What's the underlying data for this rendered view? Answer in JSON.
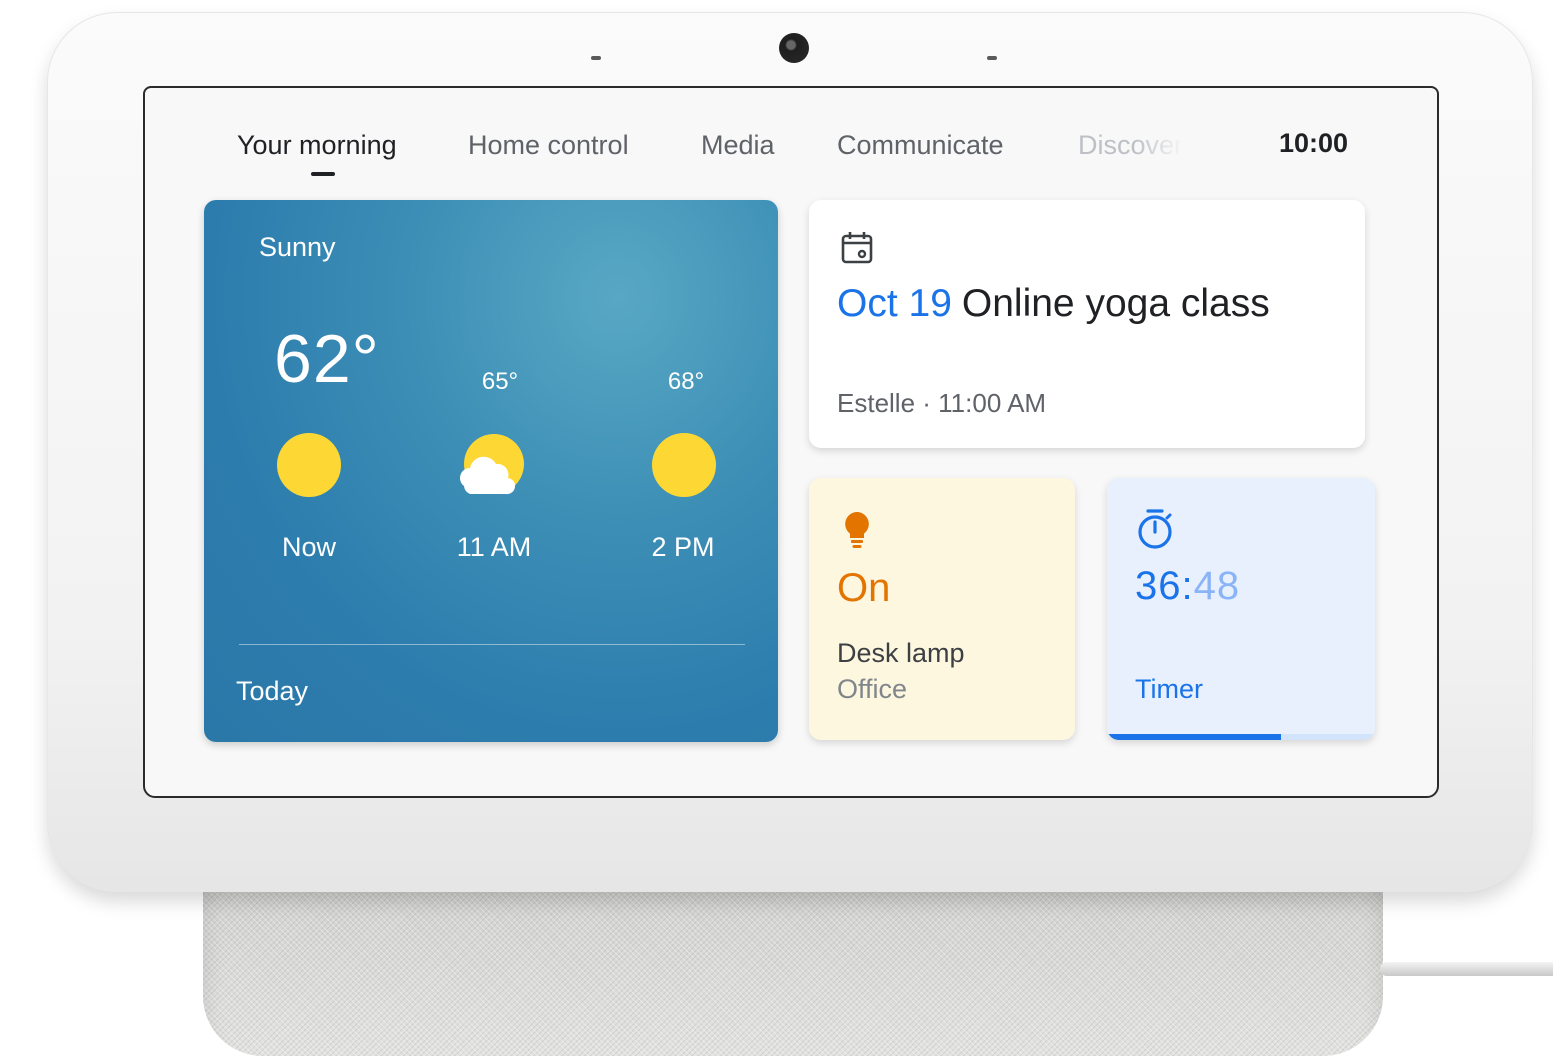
{
  "tabs": [
    {
      "label": "Your morning"
    },
    {
      "label": "Home control"
    },
    {
      "label": "Media"
    },
    {
      "label": "Communicate"
    },
    {
      "label": "Discover"
    }
  ],
  "clock": "10:00",
  "weather": {
    "condition": "Sunny",
    "current_temp": "62°",
    "forecast": [
      {
        "time": "Now",
        "icon": "sun-icon"
      },
      {
        "time": "11 AM",
        "temp": "65°",
        "icon": "partly-cloudy-icon"
      },
      {
        "time": "2 PM",
        "temp": "68°",
        "icon": "sun-icon"
      }
    ],
    "footer": "Today"
  },
  "event": {
    "icon": "calendar-icon",
    "date": "Oct 19",
    "title": "Online yoga class",
    "subtitle": "Estelle · 11:00 AM"
  },
  "lamp": {
    "icon": "lightbulb-icon",
    "state": "On",
    "name": "Desk lamp",
    "room": "Office"
  },
  "timer": {
    "icon": "stopwatch-icon",
    "minutes": "36",
    "separator": ":",
    "seconds": "48",
    "label": "Timer",
    "progress": 0.65
  },
  "colors": {
    "accent_blue": "#1a73e8",
    "lamp_orange": "#e37400",
    "sun_yellow": "#fdd835",
    "weather_blue": "#2c7cad"
  }
}
